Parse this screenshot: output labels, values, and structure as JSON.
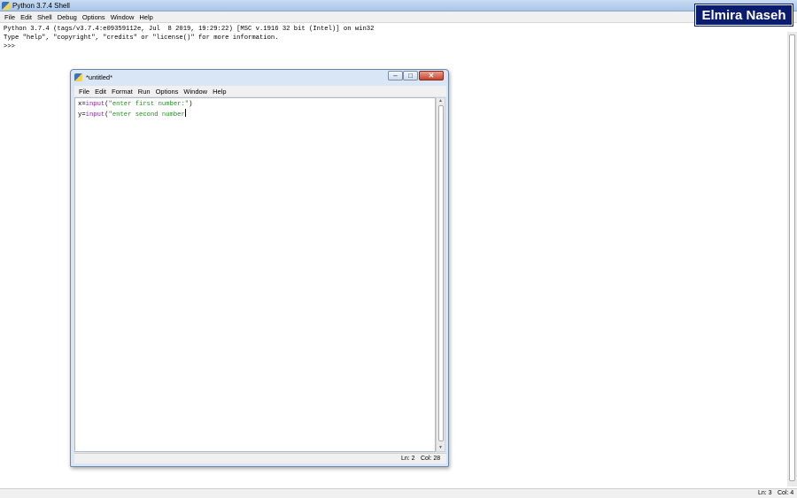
{
  "shell": {
    "title": "Python 3.7.4 Shell",
    "menu": [
      "File",
      "Edit",
      "Shell",
      "Debug",
      "Options",
      "Window",
      "Help"
    ],
    "lines": [
      "Python 3.7.4 (tags/v3.7.4:e09359112e, Jul  8 2019, 19:29:22) [MSC v.1916 32 bit (Intel)] on win32",
      "Type \"help\", \"copyright\", \"credits\" or \"license()\" for more information.",
      ">>> "
    ],
    "status": {
      "ln": "Ln: 3",
      "col": "Col: 4"
    }
  },
  "watermark": "Elmira Naseh",
  "editor": {
    "title": "*untitled*",
    "menu": [
      "File",
      "Edit",
      "Format",
      "Run",
      "Options",
      "Window",
      "Help"
    ],
    "code": [
      {
        "var": "x=",
        "builtin": "input",
        "open": "(",
        "string": "\"enter first number:\"",
        "close": ")"
      },
      {
        "var": "y=",
        "builtin": "input",
        "open": "(",
        "string": "\"enter second number",
        "close": ""
      }
    ],
    "status": {
      "ln": "Ln: 2",
      "col": "Col: 28"
    }
  },
  "colors": {
    "builtin": "#8a23b0",
    "string": "#1f8f1f",
    "close_button": "#c5452f",
    "watermark_bg": "#0b1b6e"
  },
  "icons": {
    "app": "python-icon",
    "minimize": "minimize-icon",
    "maximize": "maximize-icon",
    "close": "close-icon"
  }
}
